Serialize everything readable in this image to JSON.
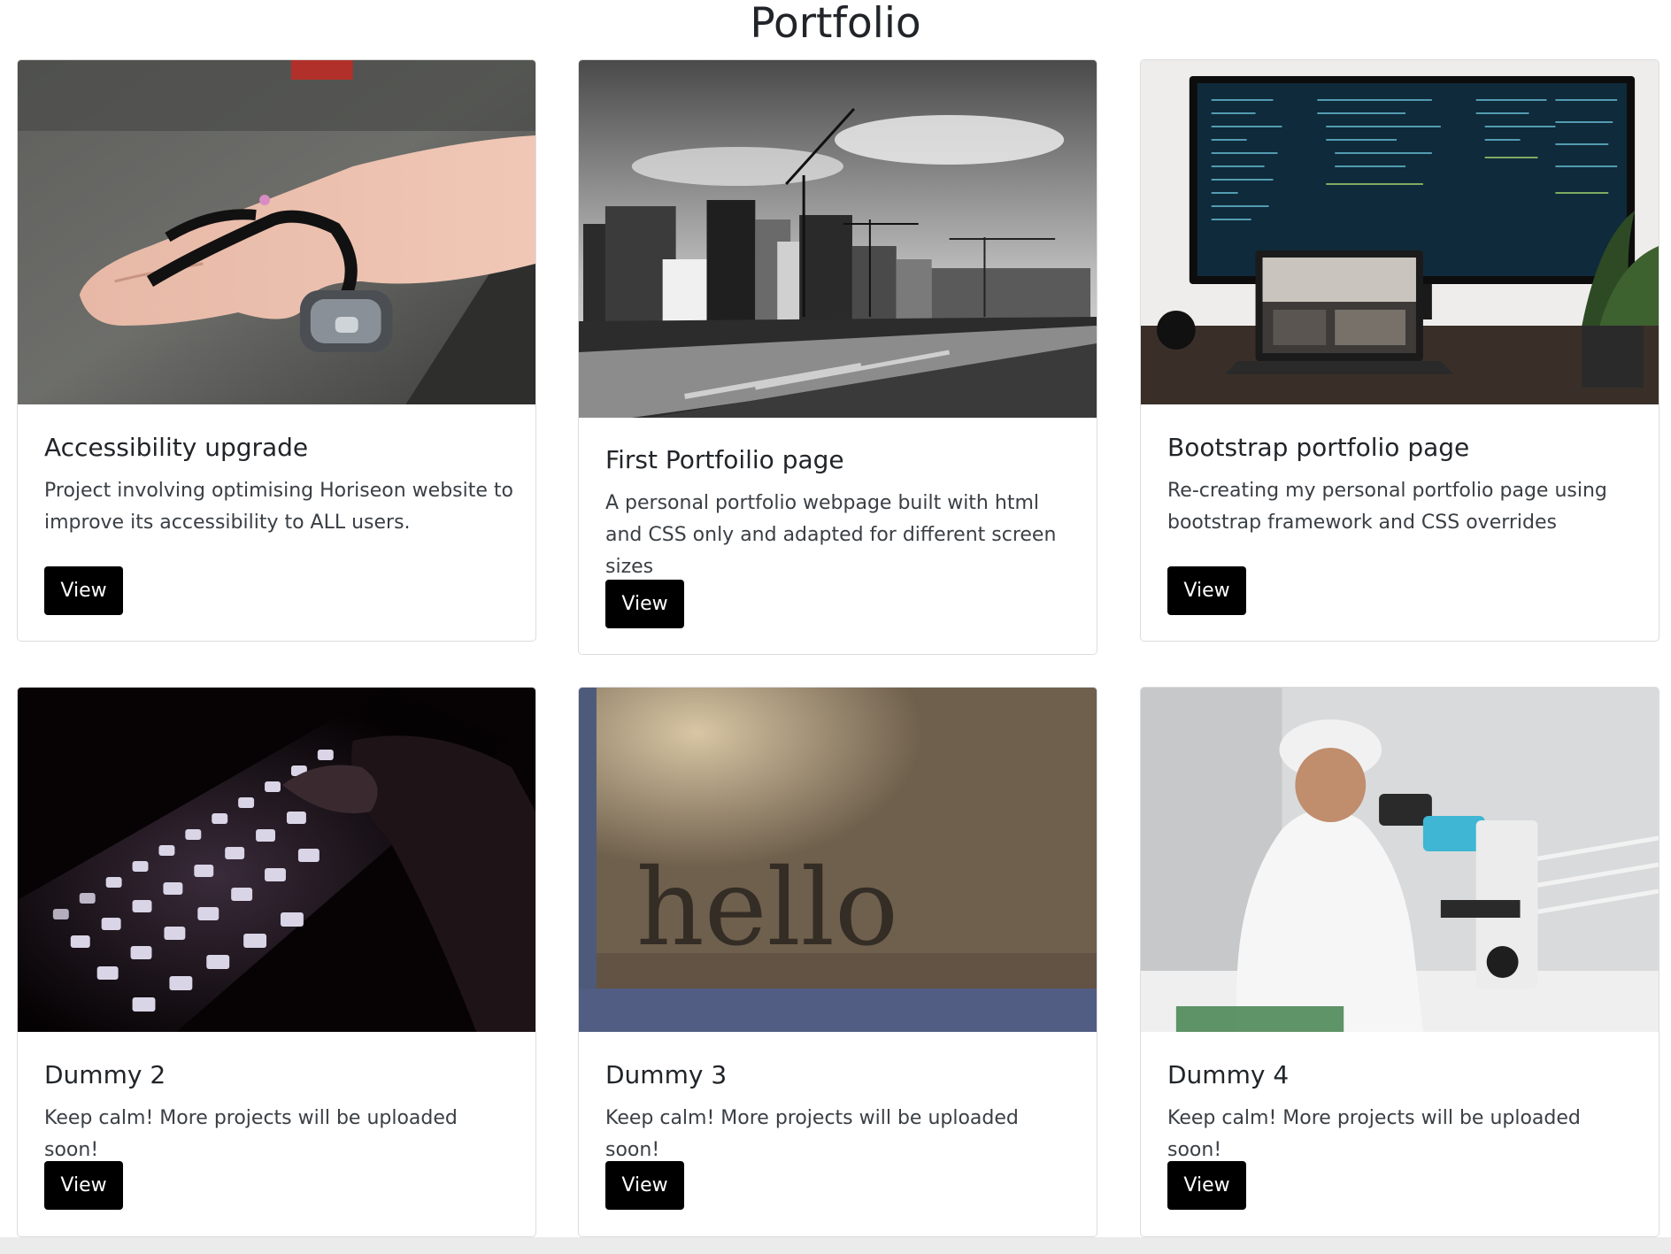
{
  "page": {
    "title": "Portfolio"
  },
  "cards": [
    {
      "title": "Accessibility upgrade",
      "text": "Project involving optimising Horiseon website to improve its accessibility to ALL users.",
      "button": "View",
      "image": "hand-with-wearable-device"
    },
    {
      "title": "First Portfoilio page",
      "text": "A personal portfolio webpage built with html and CSS only and adapted for different screen sizes",
      "button": "View",
      "image": "city-construction-black-and-white"
    },
    {
      "title": "Bootstrap portfolio page",
      "text": "Re-creating my personal portfolio page using bootstrap framework and CSS overrides",
      "button": "View",
      "image": "monitor-and-laptop-with-code"
    },
    {
      "title": "Dummy 2",
      "text": "Keep calm! More projects will be uploaded soon!",
      "button": "View",
      "image": "backlit-keyboard"
    },
    {
      "title": "Dummy 3",
      "text": "Keep calm! More projects will be uploaded soon!",
      "button": "View",
      "image": "hello-doormat",
      "image_text": "hello"
    },
    {
      "title": "Dummy 4",
      "text": "Keep calm! More projects will be uploaded soon!",
      "button": "View",
      "image": "scientist-with-microscope"
    }
  ],
  "colors": {
    "button_bg": "#000000",
    "button_text": "#ffffff",
    "card_border": "#dcdcdc",
    "footer_strip": "#ebebeb"
  }
}
